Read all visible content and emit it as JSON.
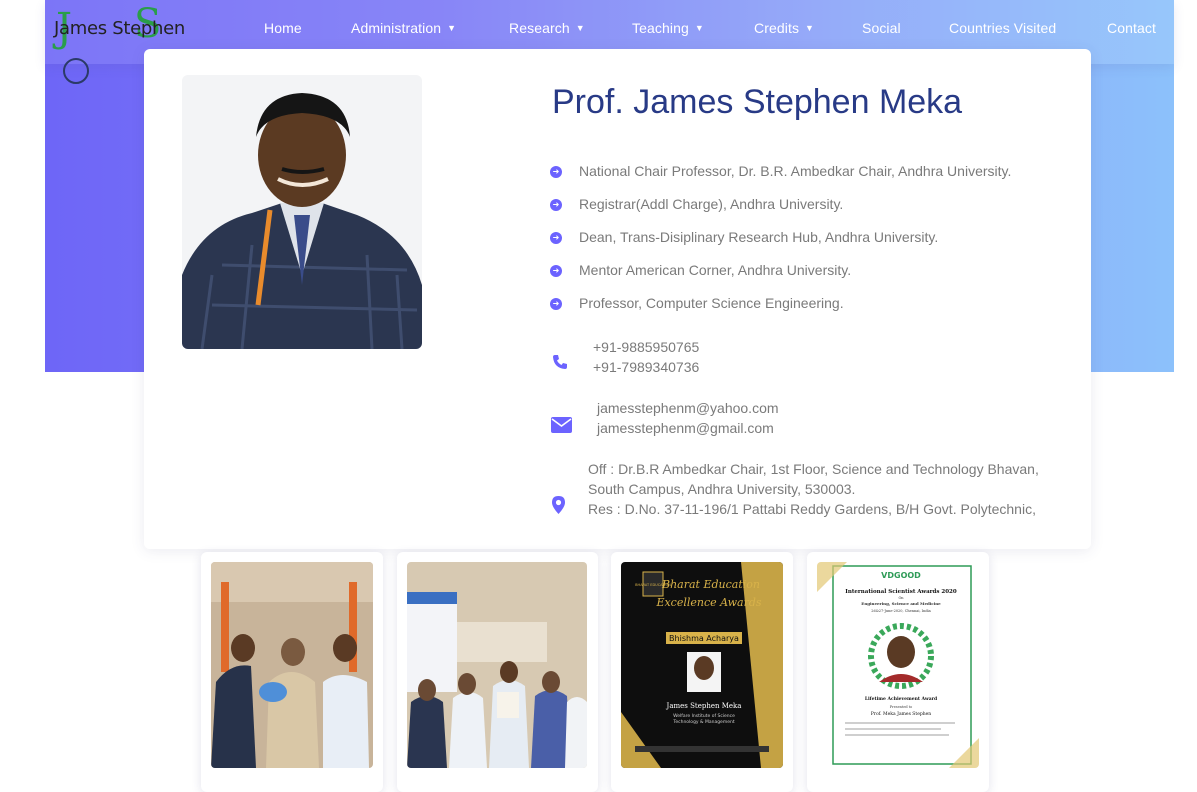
{
  "brand": {
    "name": "James Stephen",
    "monogram_j": "J",
    "monogram_s": "S",
    "colors": {
      "green": "#2a9d4a",
      "navy": "#2b3a68"
    }
  },
  "nav": {
    "items": [
      {
        "label": "Home",
        "dropdown": false
      },
      {
        "label": "Administration",
        "dropdown": true
      },
      {
        "label": "Research",
        "dropdown": true
      },
      {
        "label": "Teaching",
        "dropdown": true
      },
      {
        "label": "Credits",
        "dropdown": true
      },
      {
        "label": "Social",
        "dropdown": false
      },
      {
        "label": "Countries Visited",
        "dropdown": false
      },
      {
        "label": "Contact",
        "dropdown": false
      }
    ]
  },
  "profile": {
    "name": "Prof. James Stephen Meka",
    "positions": [
      "National Chair Professor, Dr. B.R. Ambedkar Chair, Andhra University.",
      "Registrar(Addl Charge), Andhra University.",
      "Dean, Trans-Disiplinary Research Hub, Andhra University.",
      "Mentor American Corner, Andhra University.",
      "Professor, Computer Science Engineering."
    ],
    "phones": [
      "+91-9885950765",
      "+91-7989340736"
    ],
    "emails": [
      "jamesstephenm@yahoo.com",
      "jamesstephenm@gmail.com"
    ],
    "address_lines": [
      "Off : Dr.B.R Ambedkar Chair, 1st Floor, Science and Technology Bhavan,",
      "South Campus, Andhra University, 530003.",
      "Res : D.No. 37-11-196/1 Pattabi Reddy Gardens, B/H Govt. Polytechnic,"
    ]
  },
  "gallery": {
    "award_badge": "BHARAT EDUCATION",
    "award_title_1": "Bharat Education",
    "award_title_2": "Excellence Awards",
    "award_name": "Bhishma Acharya",
    "award_recipient": "James Stephen Meka",
    "award_inst_1": "Welfare Institute of Science",
    "award_inst_2": "Technology & Management",
    "cert_brand": "VDGOOD",
    "cert_title": "International Scientist Awards 2020",
    "cert_on": "On",
    "cert_subtitle": "Engineering, Science and Medicine",
    "cert_date": "26&27-June-2020, Chennai, India",
    "cert_award": "Lifetime Achievement Award",
    "cert_presented": "Presented to",
    "cert_recipient": "Prof. Meka James Stephen"
  },
  "colors": {
    "accent": "#6c63ff",
    "title": "#283a86",
    "muted_text": "#7a7a7a",
    "hero_gradient_start": "#6e66f7",
    "hero_gradient_end": "#8cc1fb"
  }
}
